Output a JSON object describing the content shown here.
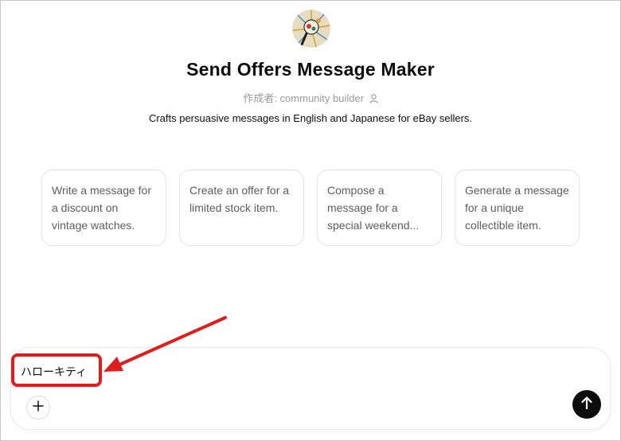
{
  "gpt": {
    "avatar_icon": "gpt-avatar-icon",
    "title": "Send Offers Message Maker",
    "author": "作成者: community builder",
    "description": "Crafts persuasive messages in English and Japanese for eBay sellers."
  },
  "suggestions": [
    {
      "label": "Write a message for a discount on vintage watches."
    },
    {
      "label": "Create an offer for a limited stock item."
    },
    {
      "label": "Compose a message for a special weekend..."
    },
    {
      "label": "Generate a message for a unique collectible item."
    }
  ],
  "composer": {
    "input_value": "ハローキティ",
    "add_icon": "plus-icon",
    "send_icon": "arrow-up-icon"
  },
  "annotation": {
    "highlight_color": "#e21b1b",
    "arrow_color": "#e21b1b"
  }
}
